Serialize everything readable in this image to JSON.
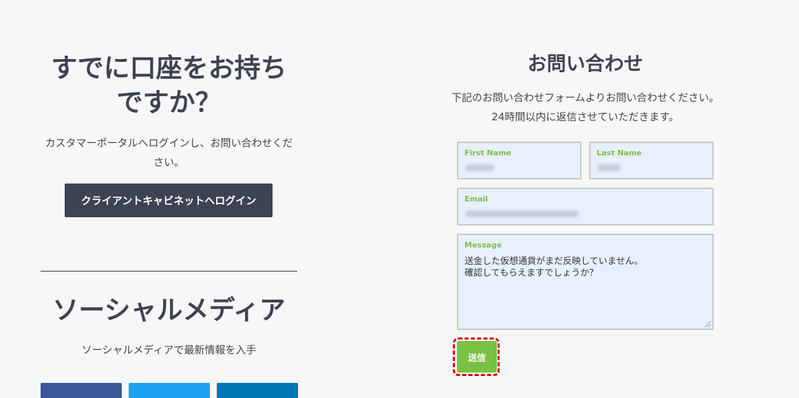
{
  "account_section": {
    "heading": "すでに口座をお持ちですか？",
    "description": "カスタマーポータルへログインし、お問い合わせください。",
    "login_button": "クライアントキャビネットへログイン"
  },
  "social_section": {
    "heading": "ソーシャルメディア",
    "description": "ソーシャルメディアで最新情報を入手",
    "buttons": [
      {
        "name": "facebook",
        "color": "#3b5998"
      },
      {
        "name": "twitter",
        "color": "#1da1f2"
      },
      {
        "name": "linkedin",
        "color": "#0077b5"
      }
    ]
  },
  "contact_section": {
    "heading": "お問い合わせ",
    "description": "下記のお問い合わせフォームよりお問い合わせください。24時間以内に返信させていただきます。",
    "form": {
      "first_name_label": "First Name",
      "last_name_label": "Last Name",
      "email_label": "Email",
      "message_label": "Message",
      "message_value": "送金した仮想通貨がまだ反映していません。\n確認してもらえますでしょうか？",
      "submit_label": "送信"
    }
  },
  "colors": {
    "dark": "#3d4350",
    "accent_green": "#79c043",
    "field_bg": "#e8f0fe",
    "highlight_red": "#d9000d"
  }
}
